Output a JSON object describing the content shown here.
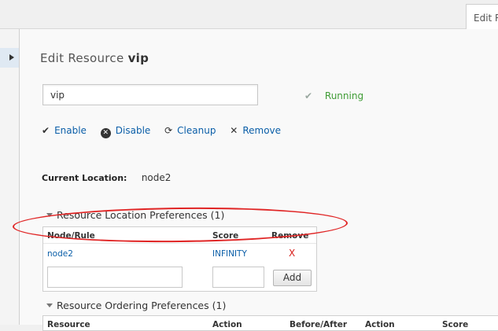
{
  "tab": {
    "label": "Edit R"
  },
  "page": {
    "title_prefix": "Edit Resource",
    "resource_name": "vip"
  },
  "name_field": {
    "value": "vip"
  },
  "status": {
    "icon": "check-icon",
    "text": "Running"
  },
  "actions": [
    {
      "icon": "check-icon",
      "label": "Enable"
    },
    {
      "icon": "x-circle-icon",
      "label": "Disable"
    },
    {
      "icon": "refresh-icon",
      "label": "Cleanup"
    },
    {
      "icon": "close-icon",
      "label": "Remove"
    }
  ],
  "current_location": {
    "label": "Current Location:",
    "value": "node2"
  },
  "location_prefs": {
    "heading": "Resource Location Preferences (1)",
    "columns": [
      "Node/Rule",
      "Score",
      "Remove"
    ],
    "rows": [
      {
        "node": "node2",
        "score": "INFINITY",
        "remove": "X"
      }
    ],
    "add_label": "Add"
  },
  "ordering_prefs": {
    "heading": "Resource Ordering Preferences (1)",
    "columns": [
      "Resource",
      "Action",
      "Before/After",
      "Action",
      "Score"
    ]
  },
  "colors": {
    "link": "#0a5ea8",
    "running": "#3f9c35",
    "remove": "#d9201c",
    "annotation": "#e02525"
  }
}
